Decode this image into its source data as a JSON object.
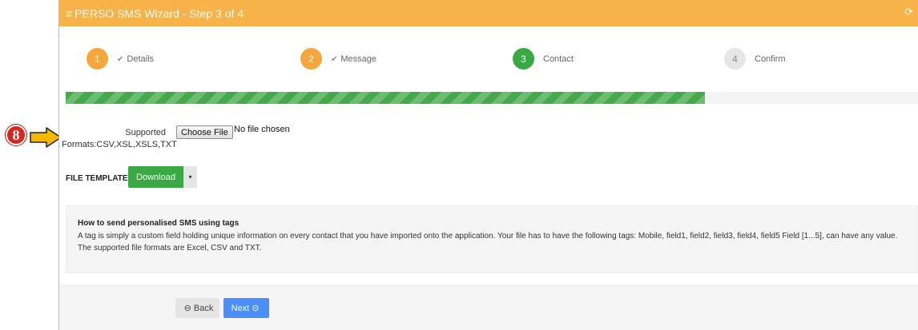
{
  "annotation": {
    "number": "8"
  },
  "header": {
    "title": "PERSO SMS Wizard - Step 3 of 4",
    "menu_icon": "bars-icon",
    "refresh_icon": "refresh-icon"
  },
  "steps": [
    {
      "number": "1",
      "label": "Details",
      "state": "done"
    },
    {
      "number": "2",
      "label": "Message",
      "state": "done"
    },
    {
      "number": "3",
      "label": "Contact",
      "state": "active"
    },
    {
      "number": "4",
      "label": "Confirm",
      "state": "todo"
    }
  ],
  "progress": {
    "percent": 75
  },
  "upload": {
    "label_line1": "Supported",
    "label_line2": "Formats:CSV,XSL,XSLS,TXT",
    "choose_label": "Choose File",
    "status": "No file chosen"
  },
  "template": {
    "label": "FILE TEMPLATE:",
    "download_label": "Download",
    "caret": "▾"
  },
  "info": {
    "title": "How to send personalised SMS using tags",
    "text": "A tag is simply a custom field holding unique information on every contact that you have imported onto the application. Your file has to have the following tags: Mobile, field1, field2, field3, field4, field5 Field [1...5], can have any value. The supported file formats are Excel, CSV and TXT."
  },
  "footer": {
    "back_label": "Back",
    "next_label": "Next"
  },
  "colors": {
    "header": "#f7b24a",
    "done": "#f5a73e",
    "active": "#3aa845",
    "next": "#4c8ef7"
  }
}
